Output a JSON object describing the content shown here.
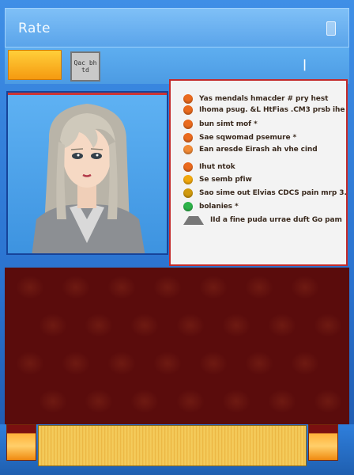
{
  "window": {
    "title": "Rate",
    "title_icon": "document-icon"
  },
  "toolbar": {
    "qr_label": "Qac bhtd",
    "mark": "|"
  },
  "portrait": {
    "icon": "female-character-avatar"
  },
  "info_list": [
    {
      "text": "Yas mendals hmacder # pry hest",
      "dot": "#ea6a1e"
    },
    {
      "text": "Ihoma psug. &L HtFias .CM3 prsb ihe",
      "dot": "#ea6a1e"
    },
    {
      "text": "bun simt mof *",
      "dot": "#ea6a1e"
    },
    {
      "text": "Sae sqwomad psemure *",
      "dot": "#ea6a1e"
    },
    {
      "text": "Ean aresde Eirash ah vhe cind",
      "dot": "#f28a36"
    },
    {
      "text": "Ihut ntok",
      "dot": "#ea6a1e"
    },
    {
      "text": "Se semb pfiw",
      "dot": "#f1a80e"
    },
    {
      "text": "Sao sime out   Elvias CDCS pain mrp 3.",
      "dot": "#d19a0e"
    },
    {
      "text": "bolanies *",
      "dot": "#2eb34a"
    },
    {
      "text": "IId a fine puda urrae duft Go pam",
      "dot": "tri"
    }
  ],
  "progress": {
    "value": 1.0
  },
  "colors": {
    "accent": "#3f8fe6",
    "panel_border": "#c42a2a",
    "board": "#5a0c0c",
    "orange": "#f59a10"
  }
}
